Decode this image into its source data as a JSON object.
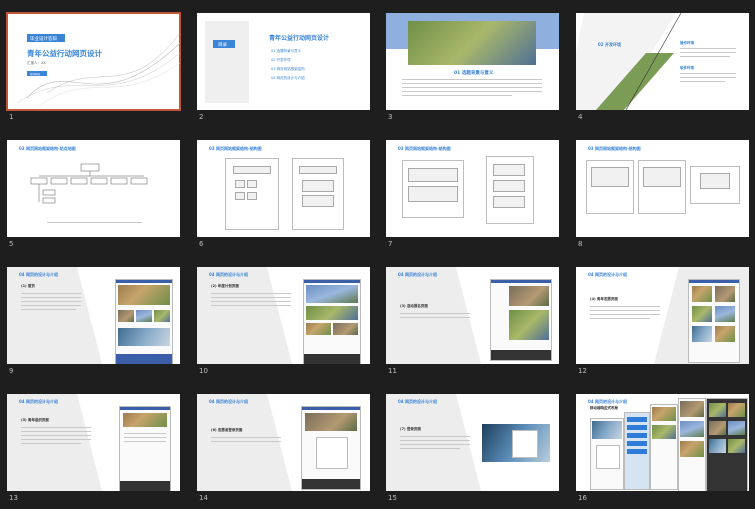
{
  "slides": [
    {
      "number": "1",
      "selected": true,
      "badge": "毕业设计答辩",
      "title": "青年公益行动网页设计",
      "subtitle": "汇报人：XX",
      "button": "答辩开始"
    },
    {
      "number": "2",
      "selected": false,
      "badge": "目录",
      "title": "青年公益行动网页设计",
      "items": [
        "01  选题背景与意义",
        "02  开发环境",
        "03  网页网站框架结构",
        "04  网页的设计与介绍"
      ]
    },
    {
      "number": "3",
      "selected": false,
      "title": "01 选题背景与意义"
    },
    {
      "number": "4",
      "selected": false,
      "title": "02 开发环境",
      "heading1": "操作环境",
      "heading2": "软件环境"
    },
    {
      "number": "5",
      "selected": false,
      "title": "03 网页网站框架结构-站点地图"
    },
    {
      "number": "6",
      "selected": false,
      "title": "03 网页网站框架结构-结构图"
    },
    {
      "number": "7",
      "selected": false,
      "title": "03 网页网站框架结构-结构图"
    },
    {
      "number": "8",
      "selected": false,
      "title": "03 网页网站框架结构-结构图"
    },
    {
      "number": "9",
      "selected": false,
      "title": "04 网页的设计与介绍",
      "section": "(1) 首页"
    },
    {
      "number": "10",
      "selected": false,
      "title": "04 网页的设计与介绍",
      "section": "(2) 年度计划页面"
    },
    {
      "number": "11",
      "selected": false,
      "title": "04 网页的设计与介绍",
      "section": "(3) 活动报名页面"
    },
    {
      "number": "12",
      "selected": false,
      "title": "04 网页的设计与介绍",
      "section": "(4) 青年志愿页面"
    },
    {
      "number": "13",
      "selected": false,
      "title": "04 网页的设计与介绍",
      "section": "(5) 青年组织页面"
    },
    {
      "number": "14",
      "selected": false,
      "title": "04 网页的设计与介绍",
      "section": "(6) 志愿者登录页面"
    },
    {
      "number": "15",
      "selected": false,
      "title": "04 网页的设计与介绍",
      "section": "(7) 登录页面"
    },
    {
      "number": "16",
      "selected": false,
      "title": "04 网页的设计与介绍",
      "section": "移动端响应式布局"
    }
  ]
}
